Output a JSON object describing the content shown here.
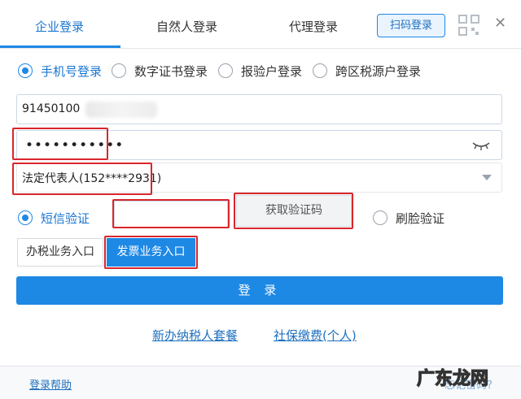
{
  "tabs": [
    {
      "label": "企业登录",
      "active": true
    },
    {
      "label": "自然人登录",
      "active": false
    },
    {
      "label": "代理登录",
      "active": false
    }
  ],
  "qr_button": {
    "label": "扫码登录"
  },
  "login_methods": [
    {
      "label": "手机号登录",
      "selected": true
    },
    {
      "label": "数字证书登录",
      "selected": false
    },
    {
      "label": "报验户登录",
      "selected": false
    },
    {
      "label": "跨区税源户登录",
      "selected": false
    }
  ],
  "credit_code": {
    "value": "91450100"
  },
  "password": {
    "masked": "•••••••••••"
  },
  "identity": {
    "value": "法定代表人(152****2931)"
  },
  "verify": {
    "sms_label": "短信验证",
    "get_code_label": "获取验证码",
    "face_label": "刷脸验证"
  },
  "entries": {
    "tax_label": "办税业务入口",
    "invoice_label": "发票业务入口"
  },
  "login_button": {
    "label": "登 录"
  },
  "links": {
    "new_taxpayer": "新办纳税人套餐",
    "social_security": "社保缴费(个人)"
  },
  "footer": {
    "help": "登录帮助",
    "forgot": "忘记密码?"
  },
  "watermark": {
    "text": "广东龙网"
  },
  "colors": {
    "accent": "#1e88e5",
    "highlight": "#d9262c"
  }
}
